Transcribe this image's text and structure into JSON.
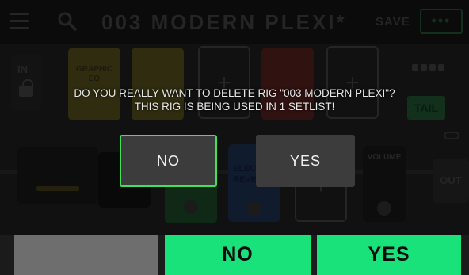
{
  "header": {
    "preset_title": "003 MODERN PLEXI*",
    "save_label": "SAVE",
    "more_label": "•••"
  },
  "signal_chain": {
    "input_label": "IN",
    "blocks": [
      {
        "label": "GRAPHIC EQ",
        "color": "#d6c235"
      },
      {
        "label": "ELECTRIC REVERB",
        "color": "#2f6be0"
      },
      {
        "label": "VOLUME",
        "color": "#3a3a3a"
      }
    ],
    "tail_label": "TAIL",
    "output_label": "OUT"
  },
  "dialog": {
    "message_line1": "DO YOU REALLY WANT TO DELETE RIG \"003 MODERN PLEXI\"?",
    "message_line2": "THIS RIG IS BEING USED IN 1 SETLIST!",
    "no_label": "NO",
    "yes_label": "YES",
    "focus_color": "#3fe25a"
  },
  "soft_keys": {
    "left_label": "",
    "middle_label": "NO",
    "right_label": "YES",
    "accent": "#19e27a"
  }
}
